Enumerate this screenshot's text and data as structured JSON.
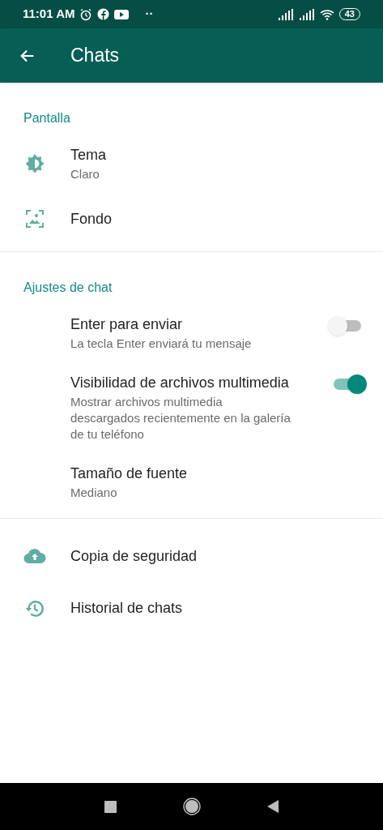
{
  "status_bar": {
    "time": "11:01 AM",
    "dots": "··",
    "battery": "43"
  },
  "app_bar": {
    "title": "Chats"
  },
  "sections": [
    {
      "header": "Pantalla",
      "items": [
        {
          "kind": "icon",
          "title": "Tema",
          "subtitle": "Claro"
        },
        {
          "kind": "icon",
          "title": "Fondo"
        }
      ]
    },
    {
      "header": "Ajustes de chat",
      "items": [
        {
          "kind": "toggle",
          "title": "Enter para enviar",
          "subtitle": "La tecla Enter enviará tu mensaje",
          "on": false
        },
        {
          "kind": "toggle",
          "title": "Visibilidad de archivos multimedia",
          "subtitle": "Mostrar archivos multimedia descargados recientemente en la galería de tu teléfono",
          "on": true
        },
        {
          "kind": "plain",
          "title": "Tamaño de fuente",
          "subtitle": "Mediano"
        }
      ]
    },
    {
      "items": [
        {
          "kind": "icon",
          "title": "Copia de seguridad"
        },
        {
          "kind": "icon",
          "title": "Historial de chats"
        }
      ]
    }
  ]
}
